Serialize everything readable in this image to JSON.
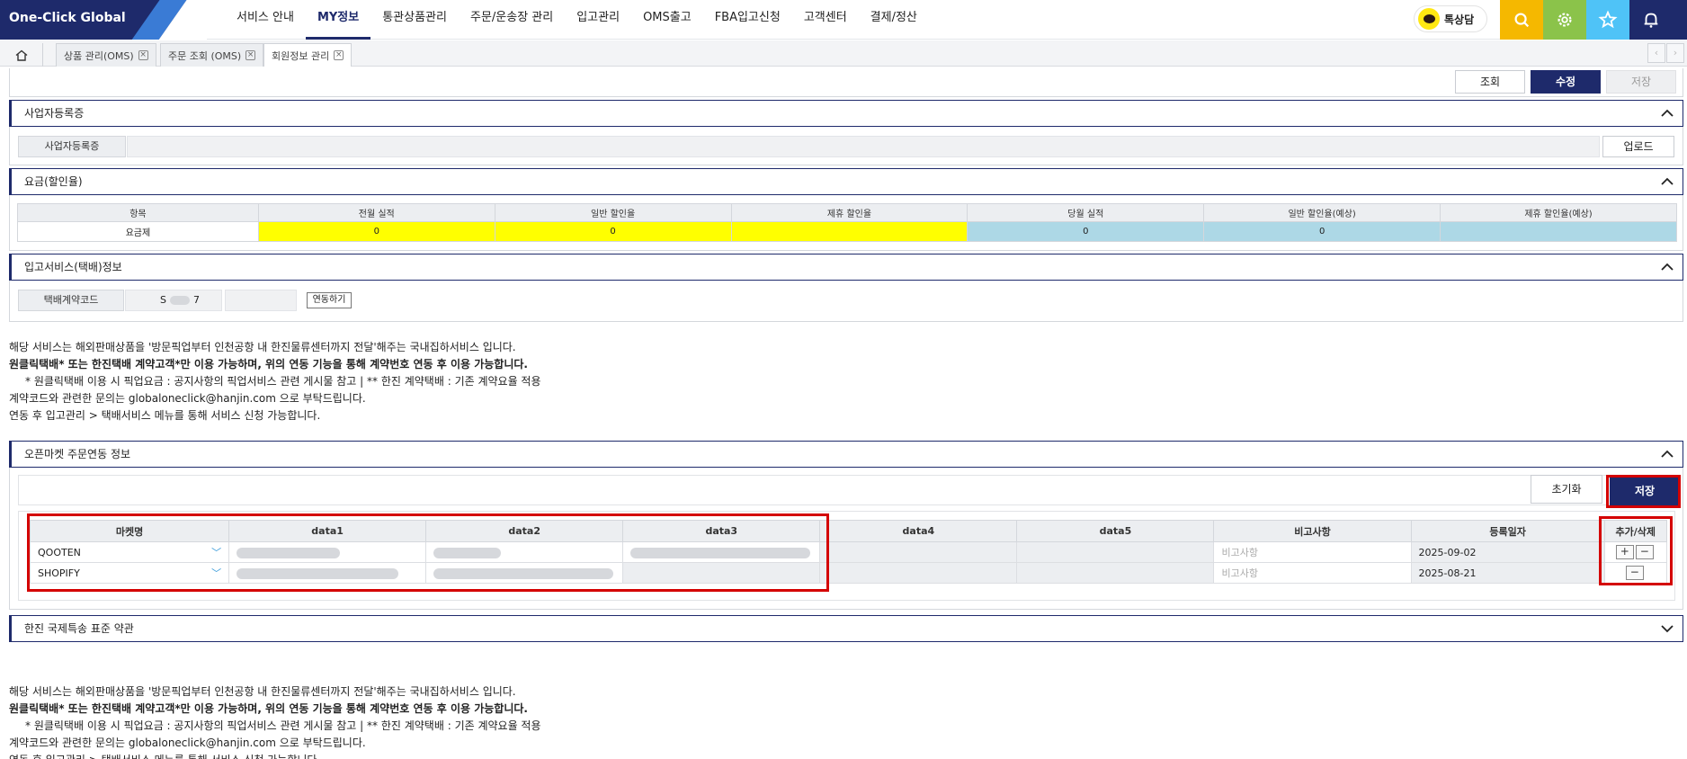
{
  "brand": "One-Click Global",
  "nav": [
    "서비스 안내",
    "MY정보",
    "통관상품관리",
    "주문/운송장 관리",
    "입고관리",
    "OMS출고",
    "FBA입고신청",
    "고객센터",
    "결제/정산"
  ],
  "chat_label": "톡상담",
  "quick_colors": [
    "#f5b800",
    "#8bc34a",
    "#4fc3f7",
    "#1e2a6b"
  ],
  "tabs": [
    "상품 관리(OMS)",
    "주문 조회 (OMS)",
    "회원정보 관리"
  ],
  "top_buttons": {
    "search": "조회",
    "edit": "수정",
    "save": "저장"
  },
  "biz": {
    "title": "사업자등록증",
    "label": "사업자등록증",
    "upload": "업로드"
  },
  "fee": {
    "title": "요금(할인율)",
    "headers": [
      "항목",
      "전월 실적",
      "일반 할인율",
      "제휴 할인율",
      "당월 실적",
      "일반 할인율(예상)",
      "제휴 할인율(예상)"
    ],
    "row": [
      "요금제",
      "0",
      "0",
      "",
      "0",
      "0",
      ""
    ]
  },
  "courier": {
    "title": "입고서비스(택배)정보",
    "label": "택배계약코드",
    "code_prefix": "S",
    "code_suffix": "7",
    "link_button": "연동하기"
  },
  "notice": {
    "line1": "해당 서비스는 해외판매상품을 '방문픽업부터 인천공항 내 한진물류센터까지 전달'해주는 국내집하서비스 입니다.",
    "line2": "원클릭택배* 또는 한진택배 계약고객*만 이용 가능하며, 위의 연동 기능을 통해 계약번호 연동 후 이용 가능합니다.",
    "line3": "* 원클릭택배 이용 시 픽업요금 : 공지사항의 픽업서비스 관련 게시물 참고  |  ** 한진 계약택배 : 기존 계약요율 적용",
    "line4": "계약코드와 관련한 문의는 globaloneclick@hanjin.com 으로 부탁드립니다.",
    "line5": "연동 후 입고관리 > 택배서비스 메뉴를 통해 서비스 신청 가능합니다."
  },
  "market": {
    "title": "오픈마켓 주문연동 정보",
    "reset": "초기화",
    "save": "저장",
    "headers": [
      "마켓명",
      "data1",
      "data2",
      "data3",
      "data4",
      "data5",
      "비고사항",
      "등록일자",
      "추가/삭제"
    ],
    "rows": [
      {
        "market": "QOOTEN",
        "memo_placeholder": "비고사항",
        "date": "2025-09-02",
        "add": "+",
        "del": "−"
      },
      {
        "market": "SHOPIFY",
        "memo_placeholder": "비고사항",
        "date": "2025-08-21",
        "del": "−"
      }
    ]
  },
  "terms": {
    "title": "한진 국제특송 표준 약관"
  },
  "highlight_color": "#d40000"
}
